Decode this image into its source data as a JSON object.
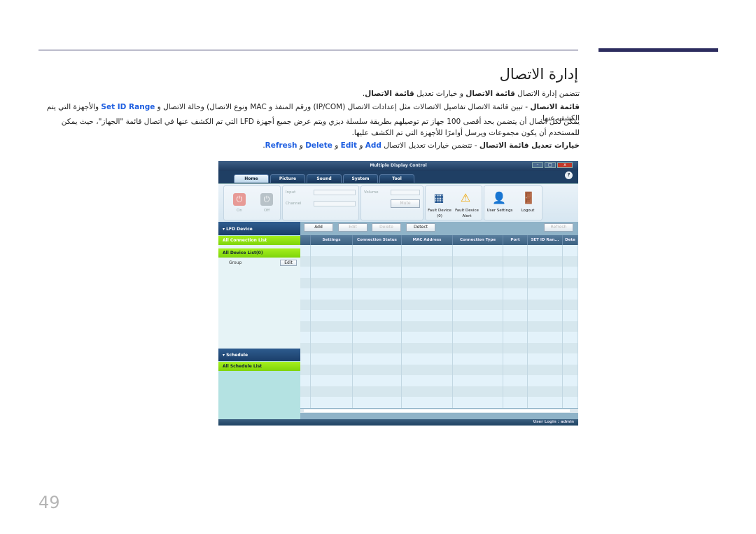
{
  "title": "إدارة الاتصال",
  "paragraphs": {
    "p1": {
      "pre": "تتضمن إدارة الاتصال ",
      "b1": "قائمة الاتصال",
      "mid": " و خيارات تعديل ",
      "b2": "قائمة الاتصال",
      "post": "."
    },
    "p2": {
      "b1": "قائمة الاتصال",
      "text": " - تبين قائمة الاتصال تفاصيل الاتصالات مثل إعدادات الاتصال (IP/COM) ورقم المنفذ و MAC ونوع الاتصال) وحالة الاتصال و ",
      "link": "Set ID Range",
      "post": " والأجهزة التي يتم الكشف عنها."
    },
    "p3": "يمكن لكل اتصال أن يتضمن بحد أقصى 100 جهاز تم توصيلهم بطريقة سلسلة ديزي ويتم عرض جميع أجهزة LFD التي تم الكشف عنها في اتصال قائمة \"الجهاز\"، حيث يمكن للمستخدم أن يكون مجموعات ويرسل أوامرًا للأجهزة التي تم الكشف عليها.",
    "p4": {
      "b1": "خيارات تعديل قائمة الاتصال",
      "text": " - تتضمن خيارات تعديل الاتصال ",
      "l1": "Add",
      "and": " و ",
      "l2": "Edit",
      "l3": "Delete",
      "l4": "Refresh",
      "end": "."
    }
  },
  "page_number": "49",
  "app": {
    "window_title": "Multiple Display Control",
    "tabs": [
      "Home",
      "Picture",
      "Sound",
      "System",
      "Tool"
    ],
    "active_tab": "Home",
    "help": "?",
    "ribbon": {
      "on": "On",
      "off": "Off",
      "input": "Input",
      "channel": "Channel",
      "volume": "Volume",
      "mute": "Mute",
      "fault_device": "Fault Device",
      "fault_count": "(0)",
      "fault_alert": "Fault Device",
      "alert": "Alert",
      "user_settings": "User Settings",
      "logout": "Logout"
    },
    "sidebar": {
      "lfd_device": "LFD Device",
      "all_connection": "All Connection List",
      "all_device": "All Device List(0)",
      "group": "Group",
      "edit": "Edit",
      "schedule": "Schedule",
      "all_schedule": "All Schedule List"
    },
    "toolbar": {
      "add": "Add",
      "edit": "Edit",
      "delete": "Delete",
      "detect": "Detect",
      "refresh": "Refresh"
    },
    "columns": [
      "",
      "Settings",
      "Connection Status",
      "MAC Address",
      "Connection Type",
      "Port",
      "SET ID Ran...",
      "Dete"
    ],
    "status": "User Login : admin"
  }
}
